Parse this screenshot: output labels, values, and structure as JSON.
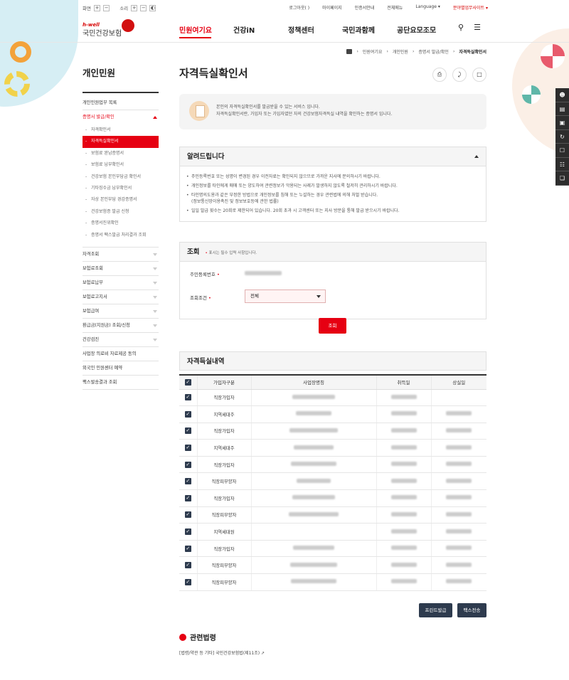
{
  "util": {
    "zoom_label": "화면",
    "sound_label": "소리",
    "plus": "+",
    "minus": "−",
    "sound_icon": "◐"
  },
  "topnav": {
    "login": "로그아웃(          )",
    "mypage": "마이페이지",
    "cert": "인증서안내",
    "sitemap": "전체메뉴",
    "language": "Language ▾",
    "sites": "분야별업무사이트 ▾"
  },
  "logo": {
    "hwell": "h-well",
    "name": "국민건강보험"
  },
  "gnb": [
    "민원여기요",
    "건강iN",
    "정책센터",
    "국민과함께",
    "공단요모조모"
  ],
  "breadcrumb": [
    "민원여기요",
    "개인민원",
    "증명서 발급/확인",
    "자격득실확인서"
  ],
  "lnb": {
    "title": "개인민원",
    "items_top": [
      "개인민원업무 목록"
    ],
    "open_item": "증명서 발급/확인",
    "subs": [
      "자격확인서",
      "자격득실확인서",
      "보험료 완납증명서",
      "보험료 납부확인서",
      "건강보험 본인부담금 확인서",
      "기타징수금 납부확인서",
      "자상 본인부담 경감증명서",
      "건강보험증 발급 신청",
      "증명서진위확인",
      "증명서 팩스발급 처리결과 조회"
    ],
    "active_sub_index": 1,
    "items_bottom": [
      "자격조회",
      "보험료조회",
      "보험료납부",
      "보험료고지서",
      "보험급여",
      "환급금(지원금) 조회/신청",
      "건강검진",
      "사업장 의료비 자료제공 동의",
      "외국인 민원센터 예약",
      "팩스발송결과 조회"
    ],
    "collapsible_count": 7
  },
  "page": {
    "title": "자격득실확인서",
    "icons": [
      "print-icon",
      "share-icon",
      "bookmark-icon"
    ],
    "info_lines": [
      "본인의 자격득실확인서를 발급받을 수 있는 서비스 입니다.",
      "자격득실확인서란, 가입자 또는 가입자였던 자의 건강보험자격득실 내역을 확인하는 증명서 입니다."
    ]
  },
  "notice": {
    "title": "알려드립니다",
    "items": [
      "주민등록번호 또는 성명이 변경된 경우 이전자료는 확인되지 않으므로 가까운 지사에 문의하시기 바랍니다.",
      "개인정보를 타인에게 매매 또는 양도하여 관련정보가 악용되는 사례가 발생하지 않도록 철저히 관리하시기 바랍니다.",
      "타인명의도용과 같은 부정한 방법으로 개인정보를 침해 또는 누설하는 경우 관련법에 의해 처벌 받습니다.",
      "일일 발급 횟수는 20회로 제한되어 있습니다. 20회 초과 시 고객센터 또는 지사 방문을 통해 발급 받으시기 바랍니다."
    ],
    "sub_note": "(정보통신망이용촉진 및 정보보호등에 관한 법률)"
  },
  "search": {
    "title": "조회",
    "required_note": "표시는 필수 입력 사항입니다.",
    "req_mark": "•",
    "ssn_label": "주민등록번호",
    "cond_label": "조회조건",
    "cond_value": "전체",
    "button": "조회"
  },
  "history": {
    "title": "자격득실내역",
    "columns": [
      "가입자구분",
      "사업장명칭",
      "취득일",
      "상실일"
    ],
    "rows": [
      {
        "type": "직장가입자",
        "has_loss": false
      },
      {
        "type": "지역세대주",
        "has_loss": true
      },
      {
        "type": "직장가입자",
        "has_loss": true
      },
      {
        "type": "지역세대주",
        "has_loss": true
      },
      {
        "type": "직장가입자",
        "has_loss": true
      },
      {
        "type": "직장피부양자",
        "has_loss": true
      },
      {
        "type": "직장가입자",
        "has_loss": true
      },
      {
        "type": "직장피부양자",
        "has_loss": true
      },
      {
        "type": "지역세대원",
        "has_loss": true
      },
      {
        "type": "직장가입자",
        "has_loss": true
      },
      {
        "type": "직장피부양자",
        "has_loss": true
      },
      {
        "type": "직장피부양자",
        "has_loss": true
      }
    ],
    "check": "✓"
  },
  "buttons": {
    "print": "프린트발급",
    "fax": "팩스전송"
  },
  "law": {
    "title": "관련법령",
    "text": "[법령/약관 등 기타] 국민건강보험법(제11조)"
  },
  "colors": {
    "accent": "#e60012",
    "dark": "#2e3b4e"
  }
}
